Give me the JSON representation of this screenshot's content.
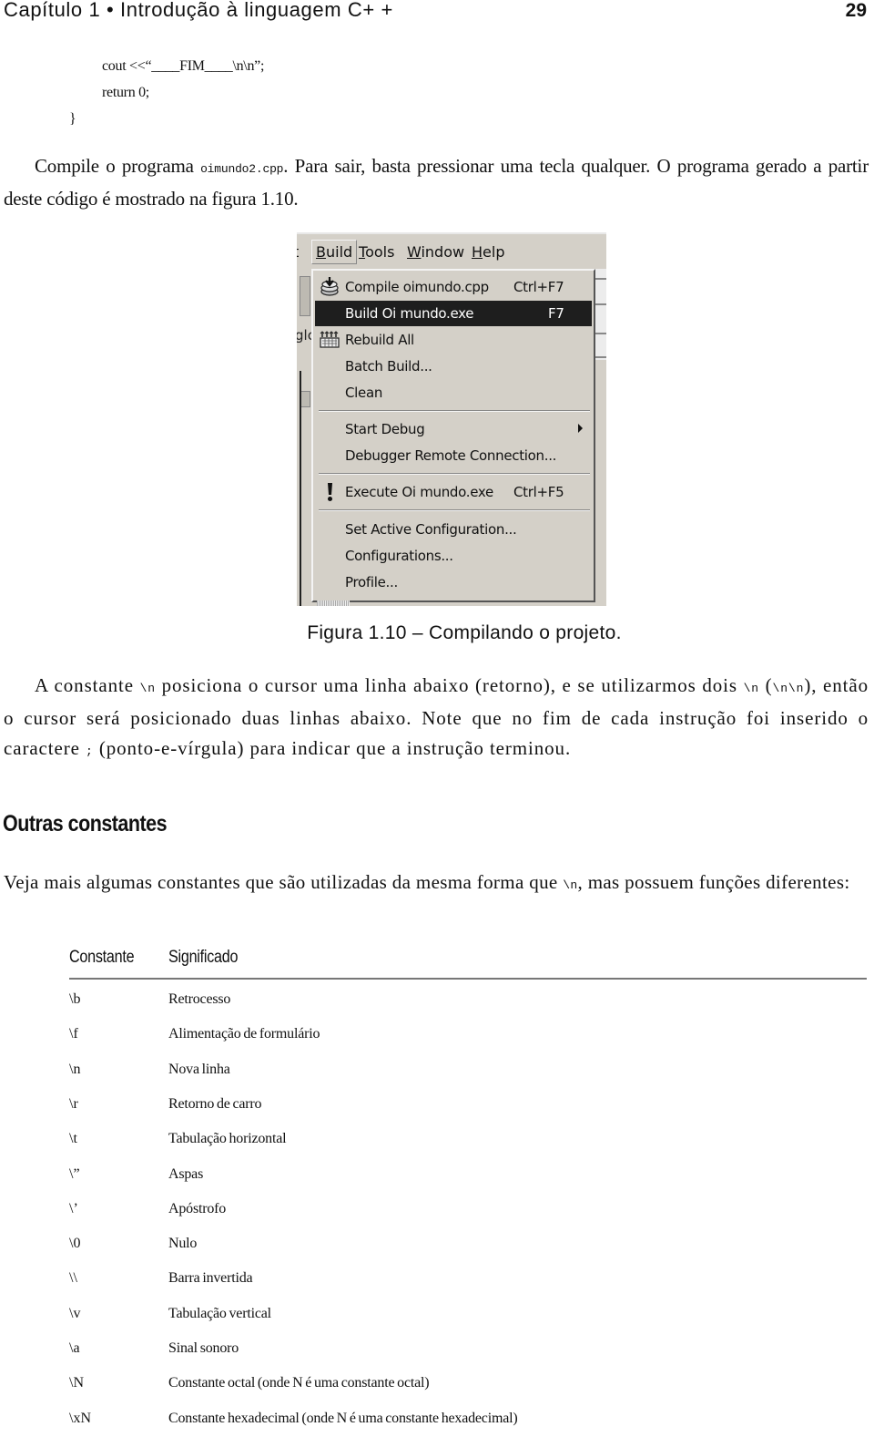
{
  "header": {
    "chapter": "Capítulo 1 • Introdução à linguagem C+ +",
    "page_number": "29"
  },
  "code": {
    "line1": "cout <<“____FIM____\\n\\n”;",
    "line2": "return 0;",
    "line3": "}"
  },
  "paragraph1": {
    "before": "Compile o programa ",
    "filename": "oimundo2.cpp",
    "after": ". Para sair, basta pressionar uma tecla qualquer. O programa gerado a partir deste código é mostrado na figura 1.10."
  },
  "figure": {
    "menubar": {
      "edge": "t",
      "items": [
        "Build",
        "Tools",
        "Window",
        "Help"
      ]
    },
    "background_fragment": "glc",
    "menu_items": [
      {
        "label": "Compile oimundo.cpp",
        "shortcut": "Ctrl+F7",
        "icon": "compile-icon"
      },
      {
        "label": "Build Oi mundo.exe",
        "shortcut": "F7",
        "highlighted": true
      },
      {
        "label": "Rebuild All",
        "icon": "rebuild-icon"
      },
      {
        "label": "Batch Build..."
      },
      {
        "label": "Clean"
      },
      {
        "label": "Start Debug",
        "submenu": true
      },
      {
        "label": "Debugger Remote Connection..."
      },
      {
        "label": "Execute Oi mundo.exe",
        "shortcut": "Ctrl+F5",
        "icon": "exclamation-icon"
      },
      {
        "label": "Set Active Configuration..."
      },
      {
        "label": "Configurations..."
      },
      {
        "label": "Profile..."
      }
    ],
    "caption": "Figura 1.10 – Compilando o projeto."
  },
  "paragraph2": {
    "t1": "A constante ",
    "c1": "\\n",
    "t2": " posiciona o cursor uma linha abaixo (retorno), e se utilizarmos dois ",
    "c2": "\\n",
    "t3": " (",
    "c3": "\\n\\n",
    "t4": "), então o cursor será posicionado duas linhas abaixo. Note que no fim de cada instrução foi inserido o caractere ",
    "c4": ";",
    "t5": " (ponto-e-vírgula) para indicar que a instrução terminou."
  },
  "section": {
    "title": "Outras constantes"
  },
  "paragraph3": {
    "t1": "Veja mais algumas constantes que são utilizadas da mesma forma que ",
    "c1": "\\n",
    "t2": ", mas possuem funções diferentes:"
  },
  "table": {
    "headers": [
      "Constante",
      "Significado"
    ],
    "rows": [
      [
        "\\b",
        "Retrocesso"
      ],
      [
        "\\f",
        "Alimentação de formulário"
      ],
      [
        "\\n",
        "Nova linha"
      ],
      [
        "\\r",
        "Retorno de carro"
      ],
      [
        "\\t",
        "Tabulação horizontal"
      ],
      [
        "\\”",
        "Aspas"
      ],
      [
        "\\’",
        "Apóstrofo"
      ],
      [
        "\\0",
        "Nulo"
      ],
      [
        "\\\\",
        "Barra invertida"
      ],
      [
        "\\v",
        "Tabulação vertical"
      ],
      [
        "\\a",
        "Sinal sonoro"
      ],
      [
        "\\N",
        "Constante octal (onde N é uma constante octal)"
      ],
      [
        "\\xN",
        "Constante hexadecimal (onde N é uma constante hexadecimal)"
      ]
    ]
  }
}
